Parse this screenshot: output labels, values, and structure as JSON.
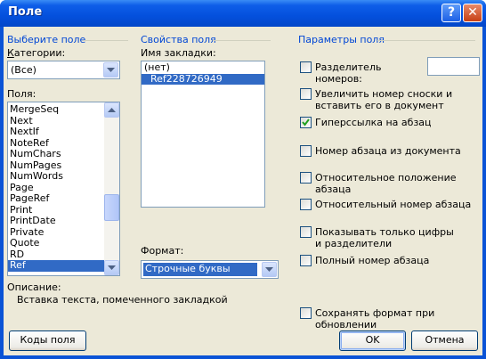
{
  "window": {
    "title": "Поле",
    "help_glyph": "?",
    "close_glyph": "✕"
  },
  "left": {
    "group_title": "Выберите поле",
    "categories_label": "Категории:",
    "categories_value": "(Все)",
    "fields_label": "Поля:",
    "fields": [
      "MergeSeq",
      "Next",
      "NextIf",
      "NoteRef",
      "NumChars",
      "NumPages",
      "NumWords",
      "Page",
      "PageRef",
      "Print",
      "PrintDate",
      "Private",
      "Quote",
      "RD",
      "Ref"
    ],
    "selected_field": "Ref",
    "description_label": "Описание:",
    "description_text": "Вставка текста, помеченного закладкой"
  },
  "middle": {
    "group_title": "Свойства поля",
    "bookmark_label": "Имя закладки:",
    "bookmarks": [
      "(нет)",
      "Ref228726949"
    ],
    "selected_bookmark": "Ref228726949",
    "format_label": "Формат:",
    "format_value": "Строчные буквы"
  },
  "right": {
    "group_title": "Параметры поля",
    "options": [
      {
        "label": "Разделитель номеров:",
        "checked": false
      },
      {
        "label": "Увеличить номер сноски и вставить его в документ",
        "checked": false
      },
      {
        "label": "Гиперссылка на абзац",
        "checked": true
      },
      {
        "label": "Номер абзаца из документа",
        "checked": false
      },
      {
        "label": "Относительное положение абзаца",
        "checked": false
      },
      {
        "label": "Относительный номер абзаца",
        "checked": false
      },
      {
        "label": "Показывать только цифры и разделители",
        "checked": false
      },
      {
        "label": "Полный номер абзаца",
        "checked": false
      }
    ],
    "separator_value": "",
    "preserve_format": {
      "label": "Сохранять формат при обновлении",
      "checked": false
    }
  },
  "buttons": {
    "field_codes": "Коды поля",
    "ok": "OK",
    "cancel": "Отмена"
  },
  "colors": {
    "title_bar": "#0450dd",
    "group_title": "#0046d5",
    "selection": "#316ac5",
    "dialog_bg": "#ece9d8",
    "check": "#21a121"
  }
}
